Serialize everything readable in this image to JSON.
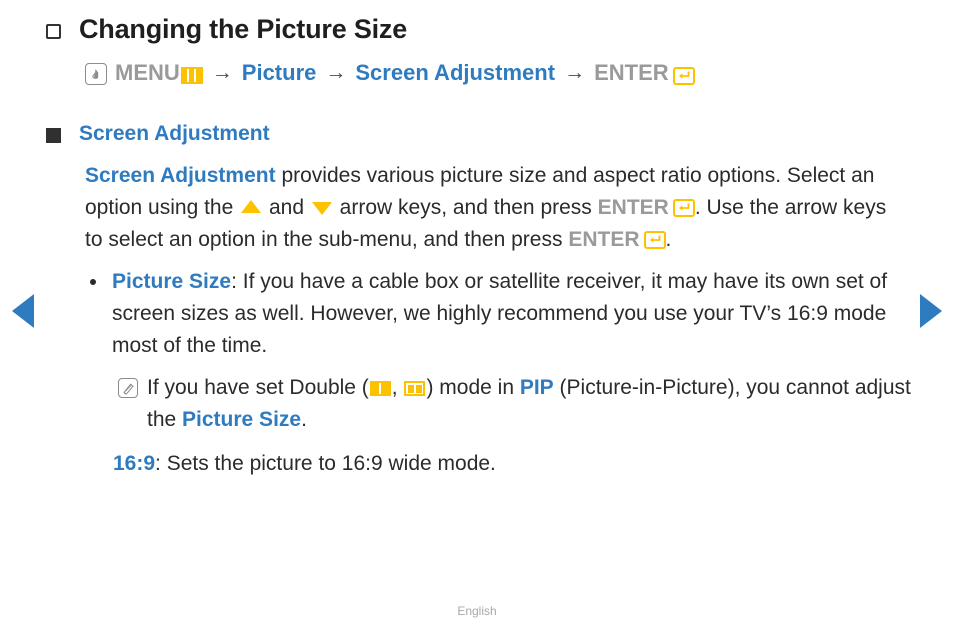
{
  "page": {
    "title": "Changing the Picture Size",
    "footer": "English",
    "colors": {
      "accent_blue": "#2f7bc0",
      "accent_amber": "#fcc200",
      "muted_gray": "#9a9a9a",
      "body_text": "#2b2b2b"
    }
  },
  "nav": {
    "prev_label": "Previous page",
    "next_label": "Next page"
  },
  "menu_path": {
    "press_icon": "hand-press-icon",
    "menu_label": "MENU",
    "menu_icon": "menu-grid-icon",
    "arrow1": "→",
    "picture_label": "Picture",
    "arrow2": "→",
    "screen_adjustment_label": "Screen Adjustment",
    "arrow3": "→",
    "enter_label": "ENTER",
    "enter_icon": "enter-return-icon"
  },
  "section": {
    "heading": "Screen Adjustment"
  },
  "paragraph": {
    "lead_term": "Screen Adjustment",
    "part1": " provides various picture size and aspect ratio options. Select an option using the ",
    "up_arrow_icon": "arrow-up-icon",
    "part2": " and ",
    "down_arrow_icon": "arrow-down-icon",
    "part3": " arrow keys, and then press ",
    "enter1": "ENTER",
    "part4": ". Use the arrow keys to select an option in the sub-menu, and then press ",
    "enter2": "ENTER",
    "part5": "."
  },
  "bullet": {
    "term": "Picture Size",
    "text": ": If you have a cable box or satellite receiver, it may have its own set of screen sizes as well. However, we highly recommend you use your TV’s 16:9 mode most of the time."
  },
  "note": {
    "icon": "note-pencil-icon",
    "part1": "If you have set Double (",
    "icon_double_a": "double-vertical-icon",
    "separator": ", ",
    "icon_double_b": "double-inset-icon",
    "part2": ") mode in ",
    "pip_term": "PIP",
    "part3": " (Picture-in-Picture), you cannot adjust the ",
    "picture_size_term": "Picture Size",
    "part4": "."
  },
  "option": {
    "term": "16:9",
    "text": ": Sets the picture to 16:9 wide mode."
  }
}
